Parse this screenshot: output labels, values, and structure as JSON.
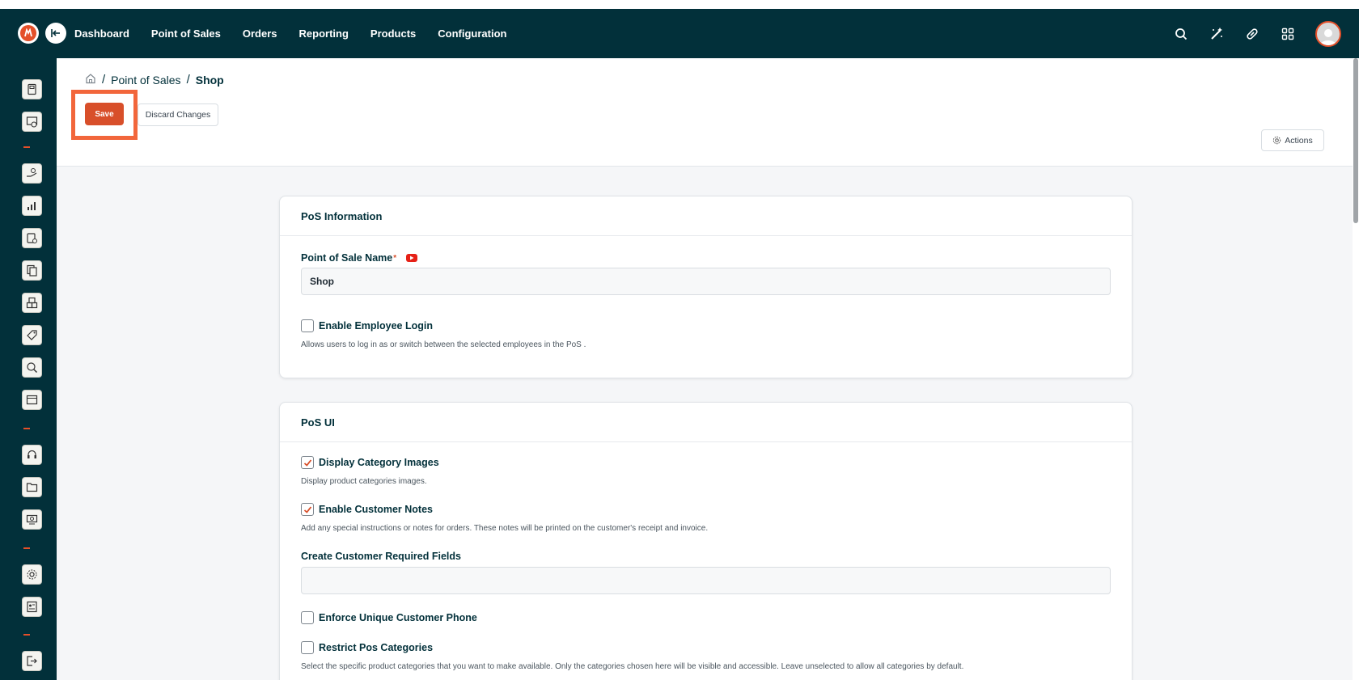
{
  "topbar": {
    "nav": [
      "Dashboard",
      "Point of Sales",
      "Orders",
      "Reporting",
      "Products",
      "Configuration"
    ],
    "icons": [
      "search-icon",
      "magic-wand-icon",
      "pill-icon",
      "apps-grid-icon",
      "avatar"
    ]
  },
  "sidebar": {
    "icons": [
      "pos-terminal-icon",
      "dashboard-chart-icon",
      "hand-money-icon",
      "bar-chart-icon",
      "clipboard-clock-icon",
      "documents-icon",
      "boxes-icon",
      "tag-icon",
      "search-person-icon",
      "calendar-icon",
      "headset-icon",
      "folder-icon",
      "screen-dollar-icon",
      "settings-gear-icon",
      "user-card-icon",
      "logout-icon"
    ]
  },
  "breadcrumb": {
    "items": [
      "Point of Sales",
      "Shop"
    ]
  },
  "toolbar": {
    "save_label": "Save",
    "discard_label": "Discard Changes",
    "actions_label": "Actions"
  },
  "pos_info": {
    "title": "PoS Information",
    "name_label": "Point of Sale Name",
    "name_required": "*",
    "name_value": "Shop",
    "employee_login_label": "Enable Employee Login",
    "employee_login_checked": false,
    "employee_login_help": "Allows users to log in as or switch between the selected employees in the PoS ."
  },
  "pos_ui": {
    "title": "PoS UI",
    "category_images_label": "Display Category Images",
    "category_images_checked": true,
    "category_images_help": "Display product categories images.",
    "customer_notes_label": "Enable Customer Notes",
    "customer_notes_checked": true,
    "customer_notes_help": "Add any special instructions or notes for orders. These notes will be printed on the customer's receipt and invoice.",
    "required_fields_label": "Create Customer Required Fields",
    "required_fields_value": "",
    "unique_phone_label": "Enforce Unique Customer Phone",
    "unique_phone_checked": false,
    "restrict_categories_label": "Restrict Pos Categories",
    "restrict_categories_checked": false,
    "restrict_categories_help": "Select the specific product categories that you want to make available. Only the categories chosen here will be visible and accessible. Leave unselected to allow all categories by default."
  },
  "colors": {
    "topbar": "#02303a",
    "accent": "#d84f2a",
    "highlight": "#f2663b"
  }
}
